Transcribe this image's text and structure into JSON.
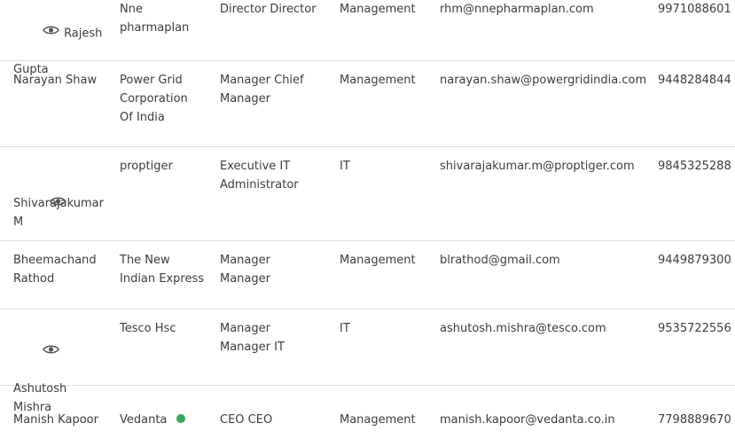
{
  "rows": [
    {
      "name": "Rajesh Gupta",
      "has_eye_icon": true,
      "company": "Nne pharmaplan",
      "title": "Director Director",
      "department": "Management",
      "email": "rhm@nnepharmaplan.com",
      "phone": "9971088601"
    },
    {
      "name": "Narayan Shaw",
      "has_eye_icon": false,
      "company": "Power Grid Corporation Of India",
      "title": "Manager Chief Manager",
      "department": "Management",
      "email": "narayan.shaw@powergridindia.com",
      "phone": "9448284844"
    },
    {
      "name": "Shivarajakumar M",
      "has_eye_icon": true,
      "company": "proptiger",
      "title": "Executive IT Administrator",
      "department": "IT",
      "email": "shivarajakumar.m@proptiger.com",
      "phone": "9845325288"
    },
    {
      "name": "Bheemachand Rathod",
      "has_eye_icon": false,
      "company": "The New Indian Express",
      "title": "Manager Manager",
      "department": "Management",
      "email": "blrathod@gmail.com",
      "phone": "9449879300"
    },
    {
      "name": "Ashutosh Mishra",
      "has_eye_icon": true,
      "company": "Tesco Hsc",
      "title": "Manager Manager IT",
      "department": "IT",
      "email": "ashutosh.mishra@tesco.com",
      "phone": "9535722556"
    },
    {
      "name": "Manish Kapoor",
      "has_eye_icon": false,
      "company": "Vedanta",
      "company_status": "online",
      "title": "CEO CEO",
      "department": "Management",
      "email": "manish.kapoor@vedanta.co.in",
      "phone": "7798889670"
    }
  ],
  "colors": {
    "text": "#3c3c3c",
    "divider": "#dcdcdc",
    "icon": "#555555",
    "status_online": "#3aa55b"
  },
  "icons": {
    "view": "eye-icon",
    "status": "status-dot"
  }
}
